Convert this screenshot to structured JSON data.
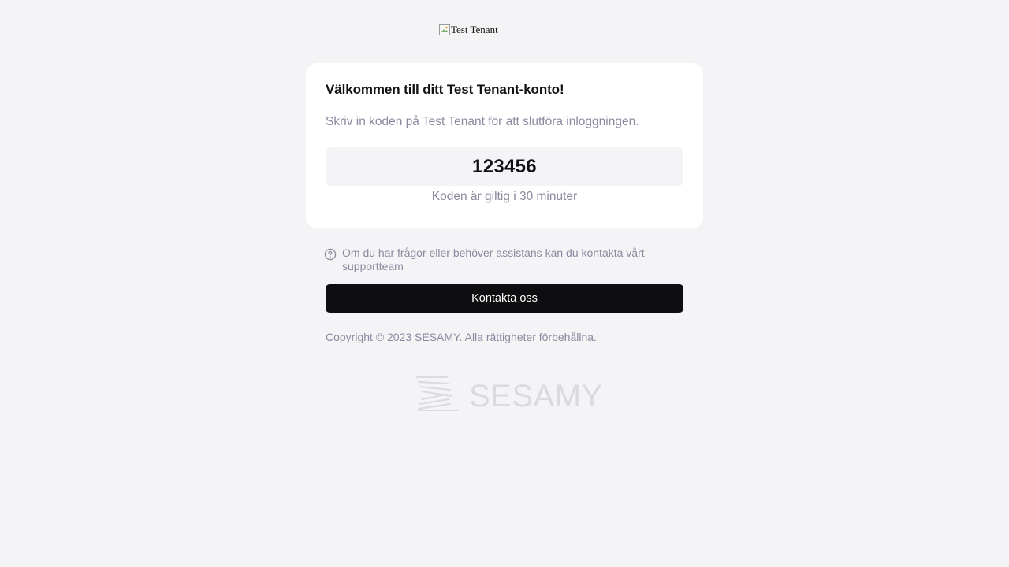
{
  "tenant_logo": {
    "alt_text": "Test Tenant"
  },
  "card": {
    "title": "Välkommen till ditt Test Tenant-konto!",
    "subtitle": "Skriv in koden på Test Tenant för att slutföra inloggningen.",
    "code": "123456",
    "validity": "Koden är giltig i 30 minuter"
  },
  "support": {
    "icon": "question-circle-icon",
    "text": "Om du har frågor eller behöver assistans kan du kontakta vårt supportteam",
    "button_label": "Kontakta oss"
  },
  "footer": {
    "copyright": "Copyright © 2023 SESAMY. Alla rättigheter förbehållna.",
    "brand_logo_text": "SESAMY"
  },
  "colors": {
    "background": "#f4f4f6",
    "card": "#ffffff",
    "muted_text": "#8a8aa0",
    "button": "#0e0e11",
    "logo": "#dadae0"
  }
}
